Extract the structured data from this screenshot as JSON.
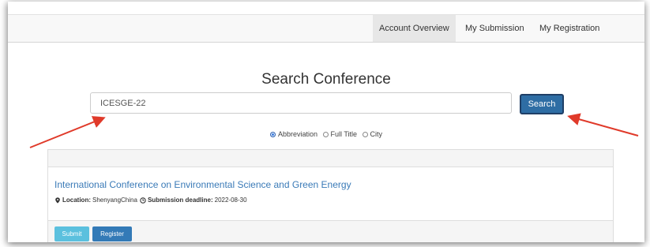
{
  "nav": {
    "items": [
      {
        "label": "Account Overview",
        "active": true
      },
      {
        "label": "My Submission",
        "active": false
      },
      {
        "label": "My Registration",
        "active": false
      }
    ]
  },
  "search": {
    "title": "Search Conference",
    "value": "ICESGE-22",
    "button_label": "Search",
    "options": [
      {
        "label": "Abbreviation",
        "checked": true
      },
      {
        "label": "Full Title",
        "checked": false
      },
      {
        "label": "City",
        "checked": false
      }
    ]
  },
  "result": {
    "title": "International Conference on Environmental Science and Green Energy",
    "location_label": "Location:",
    "location_value": "ShenyangChina",
    "deadline_label": "Submission deadline:",
    "deadline_value": "2022-08-30",
    "submit_label": "Submit",
    "register_label": "Register"
  },
  "colors": {
    "annotation_arrow": "#e03a2a",
    "search_button": "#2e6da4",
    "link": "#3a7ab7"
  }
}
